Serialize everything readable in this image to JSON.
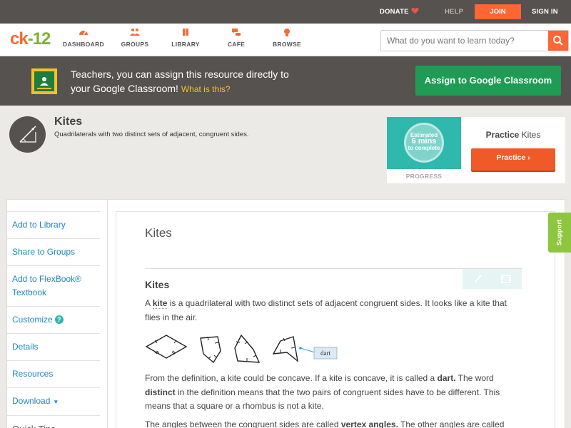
{
  "topbar": {
    "donate": "DONATE",
    "help": "HELP",
    "join": "JOIN",
    "signin": "SIGN IN"
  },
  "nav": {
    "logo_left": "ck",
    "logo_right": "-12",
    "items": [
      {
        "label": "DASHBOARD",
        "icon": "dashboard-icon"
      },
      {
        "label": "GROUPS",
        "icon": "groups-icon"
      },
      {
        "label": "LIBRARY",
        "icon": "library-icon"
      },
      {
        "label": "CAFE",
        "icon": "cafe-icon"
      },
      {
        "label": "BROWSE",
        "icon": "browse-icon"
      }
    ],
    "search_placeholder": "What do you want to learn today?"
  },
  "banner": {
    "line1": "Teachers, you can assign this resource directly to",
    "line2": "your Google Classroom!",
    "link": "What is this?",
    "button": "Assign to Google Classroom"
  },
  "concept": {
    "title": "Kites",
    "subtitle": "Quadrilaterals with two distinct sets of adjacent, congruent sides."
  },
  "practice": {
    "estimated": "Estimated",
    "mins": "6 mins",
    "to_complete": "to complete",
    "progress_label": "PROGRESS",
    "title_bold": "Practice",
    "title_rest": " Kites",
    "button": "Practice"
  },
  "sidebar": {
    "items": [
      {
        "label": "Add to Library"
      },
      {
        "label": "Share to Groups"
      },
      {
        "label": "Add to FlexBook® Textbook"
      },
      {
        "label": "Customize"
      },
      {
        "label": "Details"
      },
      {
        "label": "Resources"
      },
      {
        "label": "Download"
      }
    ],
    "quick_tips": "Quick Tips"
  },
  "content": {
    "title": "Kites",
    "section_title": "Kites",
    "p1_a": "A ",
    "p1_kite": "kite",
    "p1_b": " is a quadrilateral with two distinct sets of adjacent congruent sides. It looks like a kite that flies in the air.",
    "figure_label": "dart",
    "p2_a": "From the definition, a kite could be concave. If a kite is concave, it is called a ",
    "p2_dart": "dart.",
    "p2_b": " The word ",
    "p2_distinct": "distinct",
    "p2_c": " in the definition means that the two pairs of congruent sides have to be different. This means that a square or a rhombus is not a kite.",
    "p3_a": "The angles between the congruent sides are called ",
    "p3_vertex": "vertex angles.",
    "p3_b": " The other angles are called"
  },
  "support": "Support",
  "colors": {
    "accent_orange": "#ff6633",
    "brand_green": "#1e9c53",
    "link_blue": "#1e87c3",
    "teal": "#2fb8ac",
    "dark_bar": "#56524f"
  }
}
